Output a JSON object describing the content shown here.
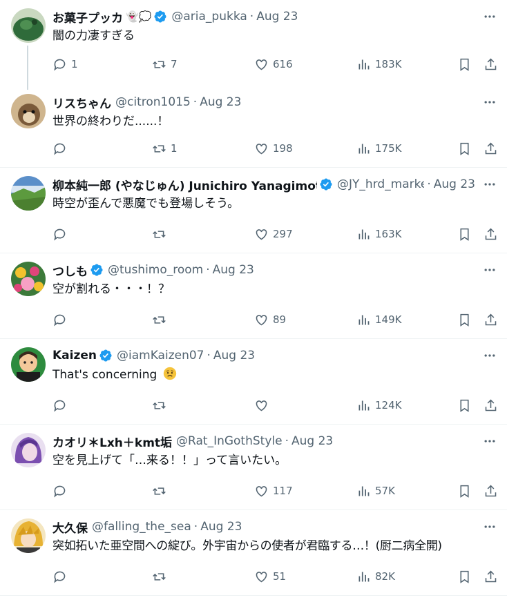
{
  "tweets": [
    {
      "name": "お菓子プッカ",
      "emojis": "👻💭",
      "verified": true,
      "handle": "@aria_pukka",
      "date": "Aug 23",
      "text": "闇の力凄すぎる",
      "text_emoji": "",
      "replies": "1",
      "retweets": "7",
      "likes": "616",
      "views": "183K",
      "avatar": "aria_pukka-avatar",
      "avatar_colors": [
        "#2f6b3a",
        "#a8c79a"
      ]
    },
    {
      "name": "リスちゃん",
      "emojis": "",
      "verified": false,
      "handle": "@citron1015",
      "date": "Aug 23",
      "text": "世界の終わりだ......！",
      "text_emoji": "",
      "replies": "",
      "retweets": "1",
      "likes": "198",
      "views": "175K",
      "avatar": "chipmunk-avatar",
      "avatar_colors": [
        "#7a5a3a",
        "#cfb58e"
      ]
    },
    {
      "name": "柳本純一郎 (やなじゅん) Junichiro Yanagimoto",
      "emojis": "",
      "verified": true,
      "handle": "@JY_hrd_marke",
      "date": "Aug 23",
      "text": "時空が歪んで悪魔でも登場しそう。",
      "text_emoji": "",
      "replies": "",
      "retweets": "",
      "likes": "297",
      "views": "163K",
      "avatar": "landscape-avatar",
      "avatar_colors": [
        "#5b8fc9",
        "#5c9a3e"
      ]
    },
    {
      "name": "つしも",
      "emojis": "",
      "verified": true,
      "handle": "@tushimo_room",
      "date": "Aug 23",
      "text": "空が割れる・・・！？",
      "text_emoji": "",
      "replies": "",
      "retweets": "",
      "likes": "89",
      "views": "149K",
      "avatar": "flowers-avatar",
      "avatar_colors": [
        "#e0457b",
        "#f2c12e"
      ]
    },
    {
      "name": "Kaizen",
      "emojis": "",
      "verified": true,
      "handle": "@iamKaizen07",
      "date": "Aug 23",
      "text": "That's concerning",
      "text_emoji": "worried-face-emoji",
      "replies": "",
      "retweets": "",
      "likes": "",
      "views": "124K",
      "avatar": "cartoon-avatar",
      "avatar_colors": [
        "#2e8b3e",
        "#f3c89a"
      ]
    },
    {
      "name": "カオリ＊Lxh＋kmt垢",
      "emojis": "",
      "verified": false,
      "handle": "@Rat_InGothStyle",
      "date": "Aug 23",
      "text": "空を見上げて「…来る！！」って言いたい。",
      "text_emoji": "",
      "replies": "",
      "retweets": "",
      "likes": "117",
      "views": "57K",
      "avatar": "anime-purple-avatar",
      "avatar_colors": [
        "#7b4fb0",
        "#f0d9e6"
      ]
    },
    {
      "name": "大久保",
      "emojis": "",
      "verified": false,
      "handle": "@falling_the_sea",
      "date": "Aug 23",
      "text": "突如拓いた亜空間への綻び。外宇宙からの使者が君臨する…！(厨二病全開)",
      "text_emoji": "",
      "replies": "",
      "retweets": "",
      "likes": "51",
      "views": "82K",
      "avatar": "anime-blonde-avatar",
      "avatar_colors": [
        "#e7b233",
        "#3a3a3a"
      ]
    }
  ],
  "colors": {
    "text": "#0f1419",
    "secondary": "#536471",
    "verified": "#1d9bf0",
    "divider": "#eff3f4"
  }
}
